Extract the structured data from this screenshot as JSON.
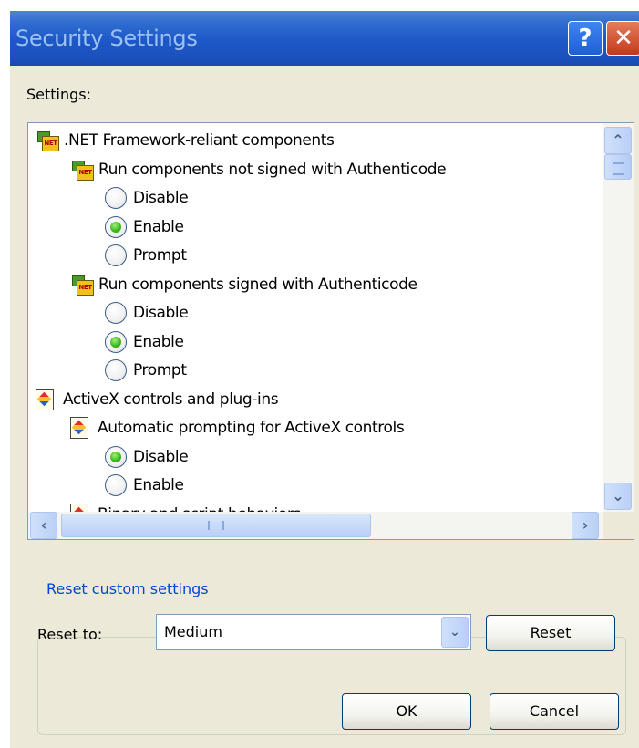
{
  "window": {
    "title": "Security Settings",
    "help_glyph": "?",
    "close_glyph": "✕"
  },
  "settings_label": "Settings:",
  "tree": {
    "items": [
      {
        "kind": "category",
        "icon": "net-framework-icon",
        "label": ".NET Framework-reliant components"
      },
      {
        "kind": "setting",
        "icon": "net-framework-icon",
        "label": "Run components not signed with Authenticode"
      },
      {
        "kind": "option",
        "label": "Disable",
        "selected": false
      },
      {
        "kind": "option",
        "label": "Enable",
        "selected": true
      },
      {
        "kind": "option",
        "label": "Prompt",
        "selected": false
      },
      {
        "kind": "setting",
        "icon": "net-framework-icon",
        "label": "Run components signed with Authenticode"
      },
      {
        "kind": "option",
        "label": "Disable",
        "selected": false
      },
      {
        "kind": "option",
        "label": "Enable",
        "selected": true
      },
      {
        "kind": "option",
        "label": "Prompt",
        "selected": false
      },
      {
        "kind": "category",
        "icon": "activex-icon",
        "label": "ActiveX controls and plug-ins"
      },
      {
        "kind": "setting",
        "icon": "activex-icon",
        "label": "Automatic prompting for ActiveX controls"
      },
      {
        "kind": "option",
        "label": "Disable",
        "selected": true
      },
      {
        "kind": "option",
        "label": "Enable",
        "selected": false
      },
      {
        "kind": "setting",
        "icon": "activex-icon",
        "label": "Binary and script behaviors"
      }
    ]
  },
  "scrollbars": {
    "up_glyph": "⌃",
    "down_glyph": "⌄",
    "left_glyph": "‹",
    "right_glyph": "›"
  },
  "reset_group": {
    "legend": "Reset custom settings",
    "reset_to_label": "Reset to:",
    "selected_level": "Medium",
    "reset_button": "Reset",
    "dropdown_glyph": "⌄"
  },
  "buttons": {
    "ok": "OK",
    "cancel": "Cancel"
  }
}
